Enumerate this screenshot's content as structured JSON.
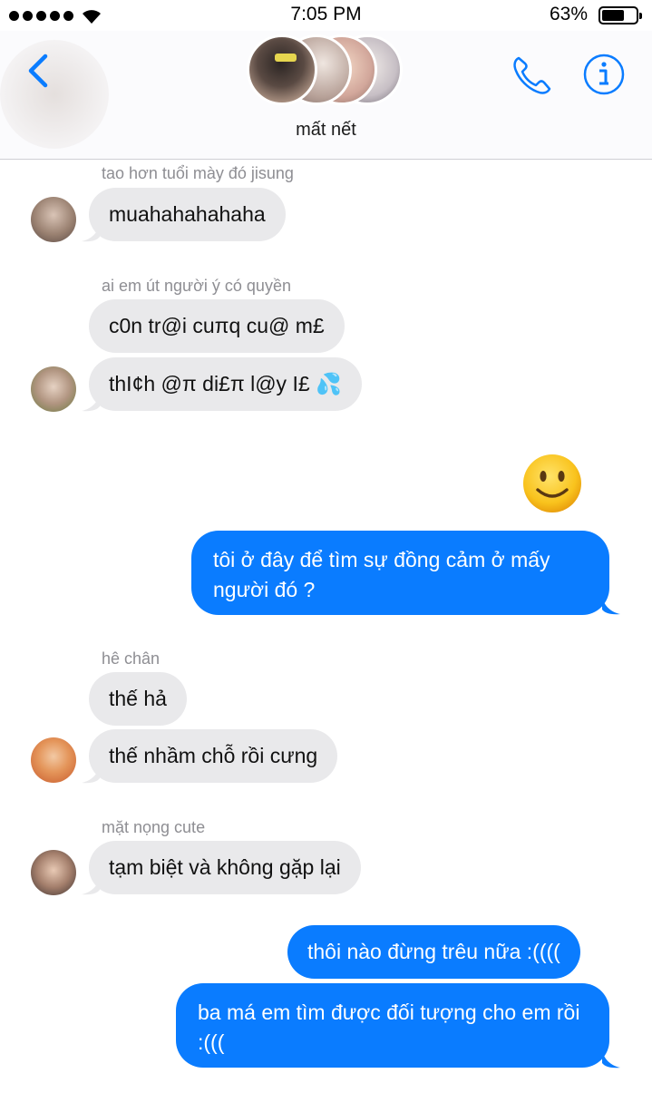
{
  "status_bar": {
    "time": "7:05 PM",
    "battery_percent": "63%",
    "battery_level": 0.63,
    "signal_bars": 5
  },
  "header": {
    "group_name": "mất nết",
    "back_icon": "chevron-left-icon",
    "call_icon": "phone-icon",
    "info_icon": "info-icon",
    "accent_color": "#0a7cff"
  },
  "messages": [
    {
      "sender": "tao hơn tuổi mày đó jisung",
      "text": "muahahahahaha"
    },
    {
      "sender": "ai em út người ý có quyền",
      "texts": [
        "c0n tr@i cuπq cu@ m£",
        "thI¢h @π di£π l@y I£ 💦"
      ]
    },
    {
      "emoji": "🙂",
      "text": "tôi ở đây để tìm sự đồng cảm ở mấy người đó ?"
    },
    {
      "sender": "hê chân",
      "texts": [
        "thế hả",
        "thế nhầm chỗ rồi cưng"
      ]
    },
    {
      "sender": "mặt nọng cute",
      "text": "tạm biệt và không gặp lại"
    },
    {
      "texts": [
        "thôi nào đừng trêu nữa :((((",
        "ba má em tìm được đối tượng cho em rồi :((("
      ]
    }
  ],
  "colors": {
    "incoming_bubble": "#e9e9eb",
    "outgoing_bubble": "#0a7cff",
    "sender_label": "#8e8e93"
  }
}
